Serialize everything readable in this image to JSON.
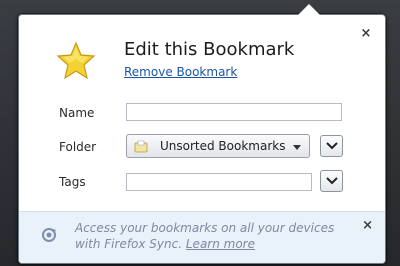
{
  "dialog": {
    "title": "Edit this Bookmark",
    "remove_link": "Remove Bookmark",
    "close_glyph": "×"
  },
  "form": {
    "name_label": "Name",
    "name_value": "",
    "folder_label": "Folder",
    "folder_value": "Unsorted Bookmarks",
    "tags_label": "Tags",
    "tags_value": ""
  },
  "footer": {
    "message": "Access your bookmarks on all your devices with Firefox Sync.",
    "link": "Learn more",
    "close_glyph": "×"
  },
  "icons": {
    "bookmark": "star-icon",
    "folder": "unsorted-bookmarks-icon",
    "sync": "sync-icon"
  },
  "colors": {
    "link": "#1a55a8",
    "footer_bg": "#e9f1fa",
    "star": "#f5d233"
  }
}
